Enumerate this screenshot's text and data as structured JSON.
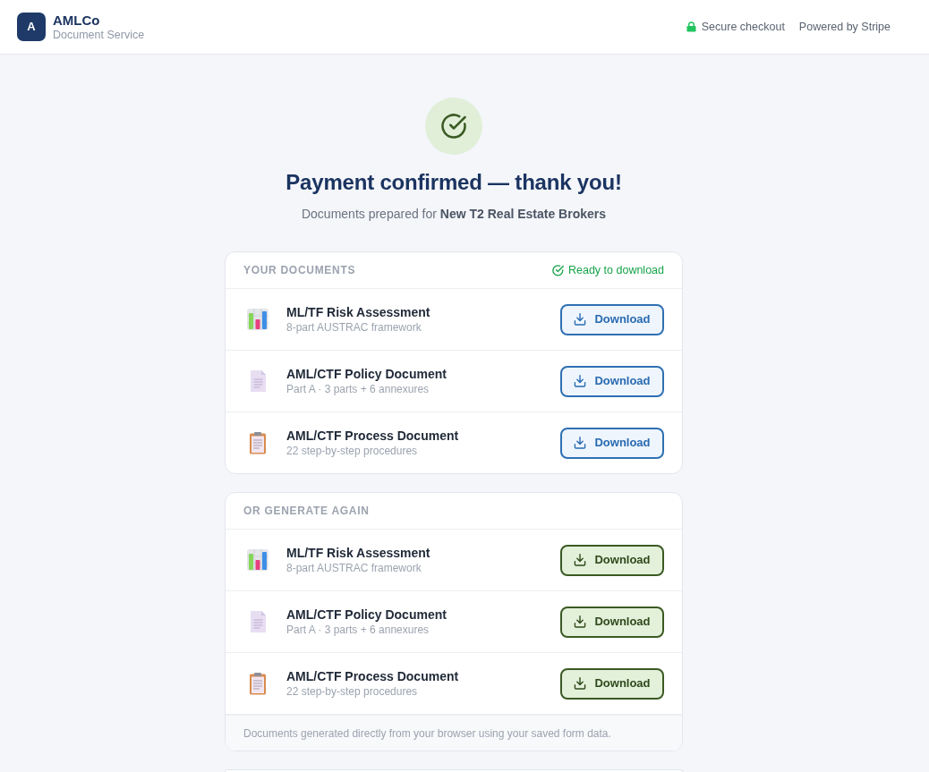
{
  "header": {
    "logo_letter": "A",
    "brand": "AMLCo",
    "tagline": "Document Service",
    "notes": [
      {
        "kind": "secure",
        "label": "Secure checkout"
      },
      {
        "kind": "plain",
        "label": "Powered by Stripe"
      }
    ]
  },
  "confirmation": {
    "title": "Payment confirmed — thank you!",
    "subtitle": "Documents prepared for **New T2 Real Estate Brokers**"
  },
  "sections": [
    {
      "kind": "saved",
      "title": "YOUR DOCUMENTS",
      "status": "Ready to download",
      "documents": [
        {
          "kind": "chart",
          "title": "ML/TF Risk Assessment",
          "subtitle": "8-part AUSTRAC framework",
          "button": "Download"
        },
        {
          "kind": "page",
          "title": "AML/CTF Policy Document",
          "subtitle": "Part A · 3 parts + 6 annexures",
          "button": "Download"
        },
        {
          "kind": "clipboard",
          "title": "AML/CTF Process Document",
          "subtitle": "22 step-by-step procedures",
          "button": "Download"
        }
      ]
    },
    {
      "kind": "generate",
      "title": "OR GENERATE AGAIN",
      "documents": [
        {
          "kind": "chart",
          "title": "ML/TF Risk Assessment",
          "subtitle": "8-part AUSTRAC framework",
          "button": "Download"
        },
        {
          "kind": "page",
          "title": "AML/CTF Policy Document",
          "subtitle": "Part A · 3 parts + 6 annexures",
          "button": "Download"
        },
        {
          "kind": "clipboard",
          "title": "AML/CTF Process Document",
          "subtitle": "22 step-by-step procedures",
          "button": "Download"
        }
      ],
      "footer": "Documents generated directly from your browser using your saved form data."
    }
  ]
}
